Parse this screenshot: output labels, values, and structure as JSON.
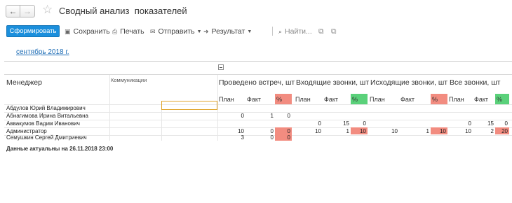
{
  "window": {
    "title": "Сводный анализ  показателей",
    "back_label": "←",
    "forward_label": "→",
    "favorite_icon": "star-icon"
  },
  "toolbar": {
    "generate_label": "Сформировать",
    "save_label": "Сохранить",
    "print_label": "Печать",
    "send_label": "Отправить",
    "result_label": "Результат",
    "find_label": "Найти...",
    "accent_color": "#1b8fdc"
  },
  "period": {
    "label": "сентябрь 2018 г."
  },
  "report": {
    "columns": {
      "manager": "Менеджер",
      "communications": "Коммуникации",
      "meetings": "Проведено встреч, шт",
      "incoming": "Входящие звонки, шт",
      "outgoing": "Исходящие звонки, шт",
      "all_calls": "Все звонки, шт"
    },
    "subcolumns": {
      "plan": "План",
      "fact": "Факт",
      "percent": "%"
    },
    "colors": {
      "percent_red": "#f28c80",
      "percent_green": "#5ad17a"
    },
    "rows": [
      {
        "name": "Абдулов Юрий Владимирович",
        "m_plan": "",
        "m_fact": "",
        "m_pct": "",
        "i_plan": "",
        "i_fact": "",
        "i_pct": "",
        "o_plan": "",
        "o_fact": "",
        "o_pct": "",
        "a_plan": "",
        "a_fact": "",
        "a_pct": ""
      },
      {
        "name": "Абнагимова Ирина Витальевна",
        "m_plan": "0",
        "m_fact": "1",
        "m_pct": "0",
        "i_plan": "",
        "i_fact": "",
        "i_pct": "",
        "o_plan": "",
        "o_fact": "",
        "o_pct": "",
        "a_plan": "",
        "a_fact": "",
        "a_pct": ""
      },
      {
        "name": "Аввакумов Вадим Иванович",
        "m_plan": "",
        "m_fact": "",
        "m_pct": "",
        "i_plan": "0",
        "i_fact": "15",
        "i_pct": "0",
        "o_plan": "",
        "o_fact": "",
        "o_pct": "",
        "a_plan": "0",
        "a_fact": "15",
        "a_pct": "0"
      },
      {
        "name": "Администратор",
        "m_plan": "10",
        "m_fact": "0",
        "m_pct": "0",
        "i_plan": "10",
        "i_fact": "1",
        "i_pct": "10",
        "o_plan": "10",
        "o_fact": "1",
        "o_pct": "10",
        "a_plan": "10",
        "a_fact": "2",
        "a_pct": "20"
      },
      {
        "name": "Семушкин Сергей Дмитриевич",
        "m_plan": "3",
        "m_fact": "0",
        "m_pct": "0",
        "i_plan": "",
        "i_fact": "",
        "i_pct": "",
        "o_plan": "",
        "o_fact": "",
        "o_pct": "",
        "a_plan": "",
        "a_fact": "",
        "a_pct": ""
      }
    ],
    "footer": "Данные актуальны на 26.11.2018 23:00"
  }
}
